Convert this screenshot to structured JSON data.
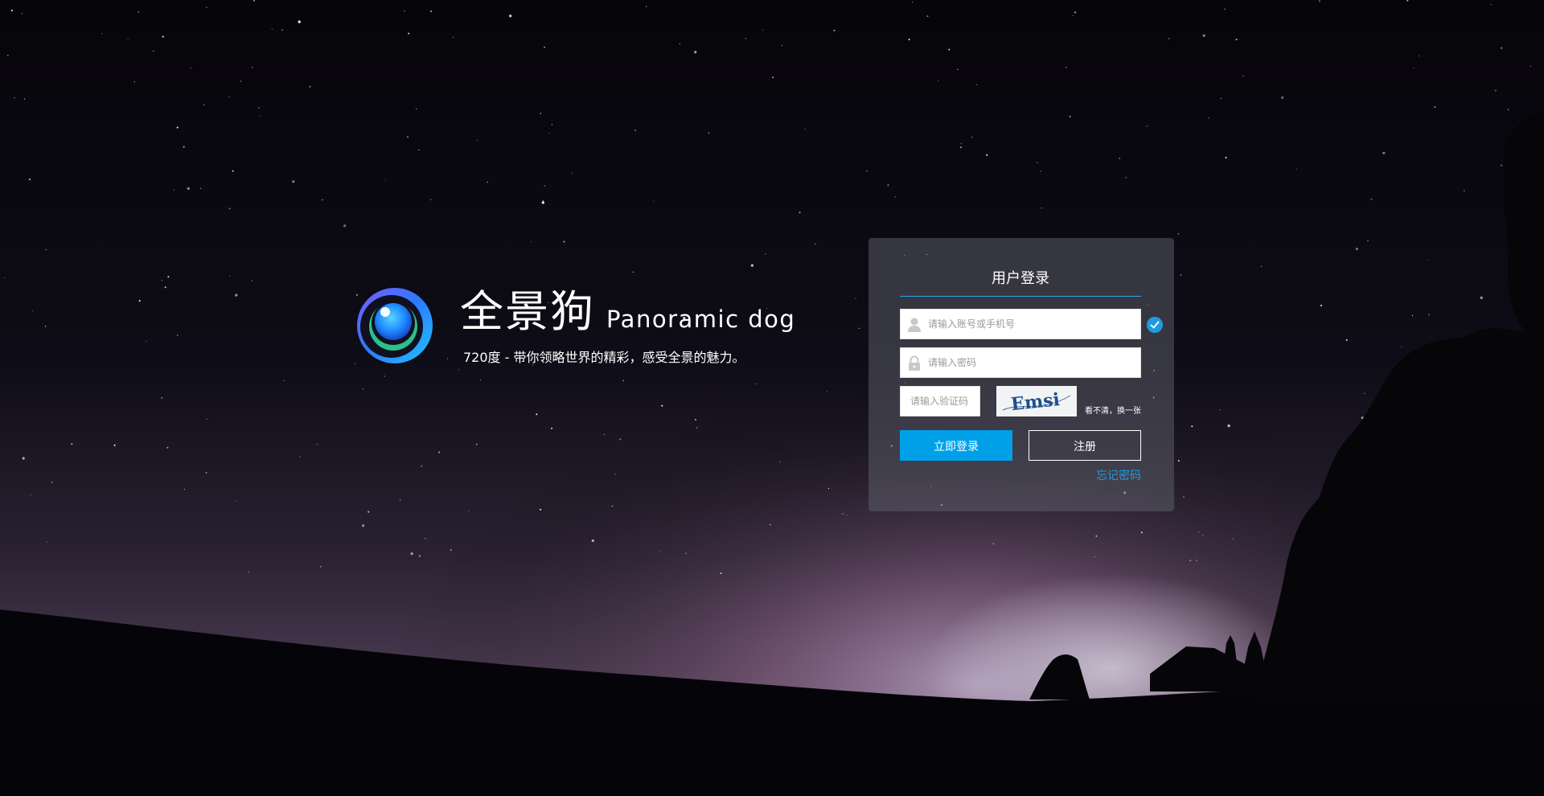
{
  "brand": {
    "name": "全景狗",
    "name_en": "Panoramic dog",
    "slogan": "720度 - 带你领略世界的精彩，感受全景的魅力。",
    "logo_icon": "panorama-eye-logo"
  },
  "login": {
    "title": "用户登录",
    "account_placeholder": "请输入账号或手机号",
    "password_placeholder": "请输入密码",
    "captcha_placeholder": "请输入验证码",
    "captcha_text": "Emsi",
    "captcha_refresh": "看不清，换一张",
    "login_button": "立即登录",
    "register_button": "注册",
    "forgot_link": "忘记密码",
    "icons": {
      "account": "user-icon",
      "password": "lock-icon",
      "valid": "check-circle-icon"
    }
  },
  "colors": {
    "accent": "#00a0e9",
    "link": "#1e9be0",
    "panel_bg": "rgba(95, 97, 110, 0.5)",
    "sky_top": "#07060c",
    "horizon_glow": "#8a6a8e"
  }
}
